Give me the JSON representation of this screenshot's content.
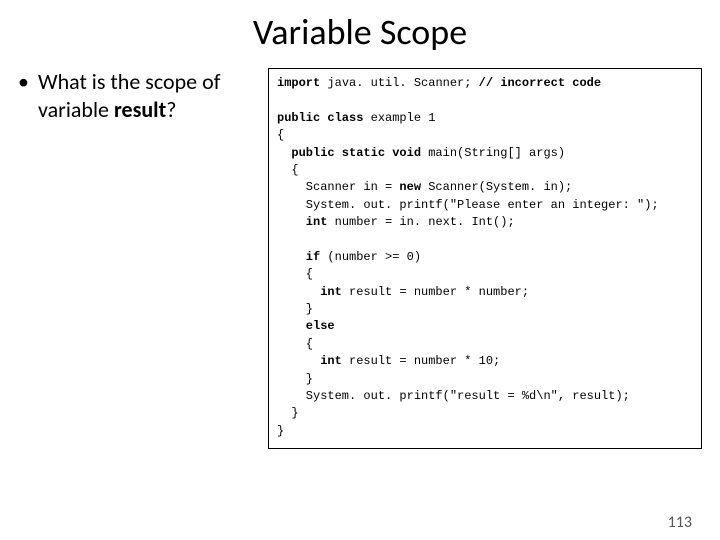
{
  "title": "Variable Scope",
  "bullet": {
    "mark": "•",
    "prefix": "What is the scope of variable ",
    "bold": "result",
    "suffix": "?"
  },
  "code": {
    "l01_a": "import",
    "l01_b": " java. util. Scanner; ",
    "l01_c": "// incorrect code",
    "l02": "",
    "l03_a": "public class",
    "l03_b": " example 1",
    "l04": "{",
    "l05_a": "  public static void",
    "l05_b": " main(String[] args)",
    "l06": "  {",
    "l07_a": "    Scanner in = ",
    "l07_b": "new",
    "l07_c": " Scanner(System. in);",
    "l08": "    System. out. printf(\"Please enter an integer: \");",
    "l09_a": "    int",
    "l09_b": " number = in. next. Int();",
    "l10": "",
    "l11_a": "    if",
    "l11_b": " (number >= 0)",
    "l12": "    {",
    "l13_a": "      int",
    "l13_b": " result = number * number;",
    "l14": "    }",
    "l15_a": "    else",
    "l16": "    {",
    "l17_a": "      int",
    "l17_b": " result = number * 10;",
    "l18": "    }",
    "l19": "    System. out. printf(\"result = %d\\n\", result);",
    "l20": "  }",
    "l21": "}"
  },
  "pageNumber": "113"
}
